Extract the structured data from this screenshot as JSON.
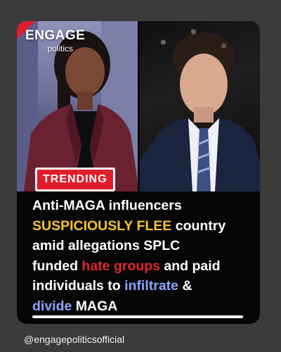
{
  "brand": {
    "name": "ENGAGE",
    "subtitle": "politics"
  },
  "badge": {
    "label": "TRENDING"
  },
  "headline": {
    "line1": "Anti-MAGA influencers",
    "line2_highlight": "SUSPICIOUSLY FLEE",
    "line2_rest": " country",
    "line3": "amid allegations SPLC",
    "line4_start": "funded ",
    "line4_highlight": "hate groups",
    "line4_rest": " and paid",
    "line5_start": "individuals to ",
    "line5_highlight": "infiltrate",
    "line5_rest": " &",
    "line6_highlight": "divide",
    "line6_rest": " MAGA"
  },
  "account": {
    "handle": "@engagepoliticsofficial"
  },
  "colors": {
    "accent_red": "#e11d2c",
    "highlight_yellow": "#f4c430",
    "highlight_red": "#e0262b",
    "highlight_blue": "#8aa4ff",
    "card_bg": "#060606",
    "page_bg": "#3b3b3b"
  }
}
